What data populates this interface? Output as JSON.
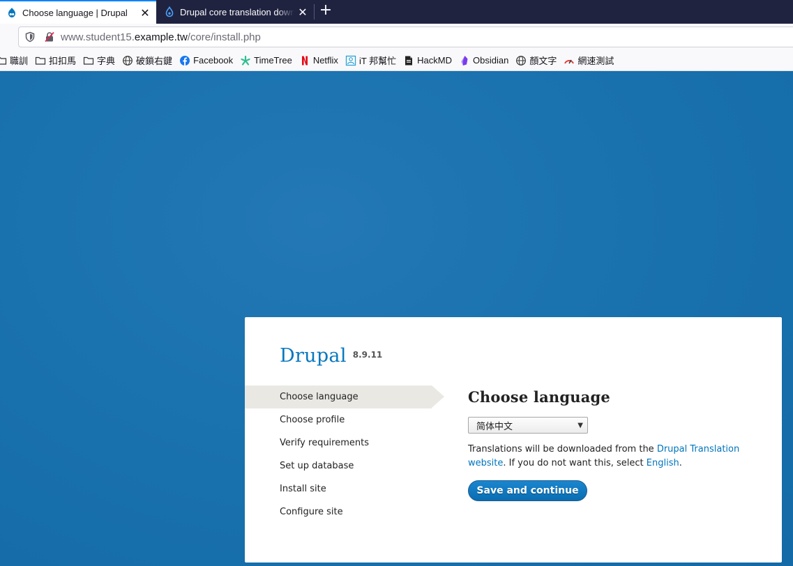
{
  "browser": {
    "tabs": [
      {
        "title": "Choose language | Drupal",
        "active": true
      },
      {
        "title": "Drupal core translation download",
        "active": false
      }
    ],
    "new_tab_label": "+",
    "close_label": "✕",
    "url": {
      "prefix": "www.student15.",
      "host": "example.tw",
      "path": "/core/install.php"
    },
    "bookmarks": [
      {
        "label": "職訓",
        "icon": "folder-icon"
      },
      {
        "label": "扣扣馬",
        "icon": "folder-icon"
      },
      {
        "label": "字典",
        "icon": "folder-icon"
      },
      {
        "label": "破鎖右鍵",
        "icon": "globe-icon"
      },
      {
        "label": "Facebook",
        "icon": "facebook-icon"
      },
      {
        "label": "TimeTree",
        "icon": "timetree-icon"
      },
      {
        "label": "Netflix",
        "icon": "netflix-icon"
      },
      {
        "label": "iT 邦幫忙",
        "icon": "ithome-icon"
      },
      {
        "label": "HackMD",
        "icon": "hackmd-icon"
      },
      {
        "label": "Obsidian",
        "icon": "obsidian-icon"
      },
      {
        "label": "顏文字",
        "icon": "globe-icon"
      },
      {
        "label": "網速測試",
        "icon": "speedtest-icon"
      }
    ]
  },
  "installer": {
    "brand": "Drupal",
    "version": "8.9.11",
    "steps": [
      {
        "label": "Choose language",
        "active": true
      },
      {
        "label": "Choose profile",
        "active": false
      },
      {
        "label": "Verify requirements",
        "active": false
      },
      {
        "label": "Set up database",
        "active": false
      },
      {
        "label": "Install site",
        "active": false
      },
      {
        "label": "Configure site",
        "active": false
      }
    ],
    "heading": "Choose language",
    "language_select": {
      "value": "简体中文"
    },
    "desc": {
      "part1": "Translations will be downloaded from the ",
      "link1": "Drupal Translation website",
      "part2": ". If you do not want this, select ",
      "link2": "English",
      "part3": "."
    },
    "submit_label": "Save and continue"
  },
  "colors": {
    "page_background": "#1a6ea6",
    "accent": "#0678be",
    "link": "#0074bd",
    "active_step": "#e9e8e3",
    "button": "#0a6db1"
  }
}
